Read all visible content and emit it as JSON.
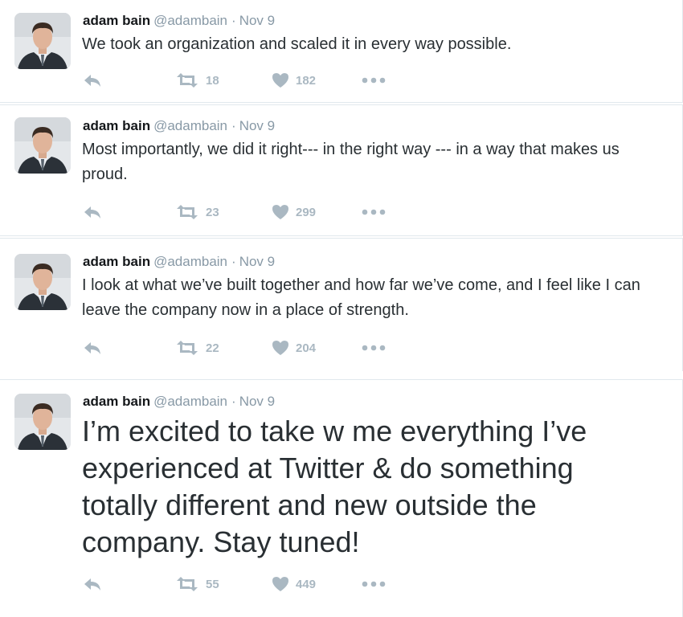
{
  "tweets": [
    {
      "name": "adam bain",
      "handle": "@adambain",
      "date": "Nov 9",
      "text": "We took an organization and scaled it in every way possible.",
      "retweets": "18",
      "likes": "182"
    },
    {
      "name": "adam bain",
      "handle": "@adambain",
      "date": "Nov 9",
      "text": "Most importantly, we did it right--- in the right way --- in a way that makes us proud.",
      "retweets": "23",
      "likes": "299"
    },
    {
      "name": "adam bain",
      "handle": "@adambain",
      "date": "Nov 9",
      "text": "I look at what we’ve built together and how far we’ve come, and I feel like I can leave the company now in a place of strength.",
      "retweets": "22",
      "likes": "204"
    },
    {
      "name": "adam bain",
      "handle": "@adambain",
      "date": "Nov 9",
      "text": "I’m excited to take w me everything I’ve experienced at Twitter & do something totally different and new outside the company. Stay tuned!",
      "retweets": "55",
      "likes": "449"
    }
  ],
  "icons": {
    "reply": "reply-icon",
    "retweet": "retweet-icon",
    "like": "heart-icon",
    "more": "more-dots-icon"
  },
  "colors": {
    "text": "#292f33",
    "muted": "#8899a6",
    "icon": "#aab8c2",
    "border": "#e1e8ed"
  }
}
